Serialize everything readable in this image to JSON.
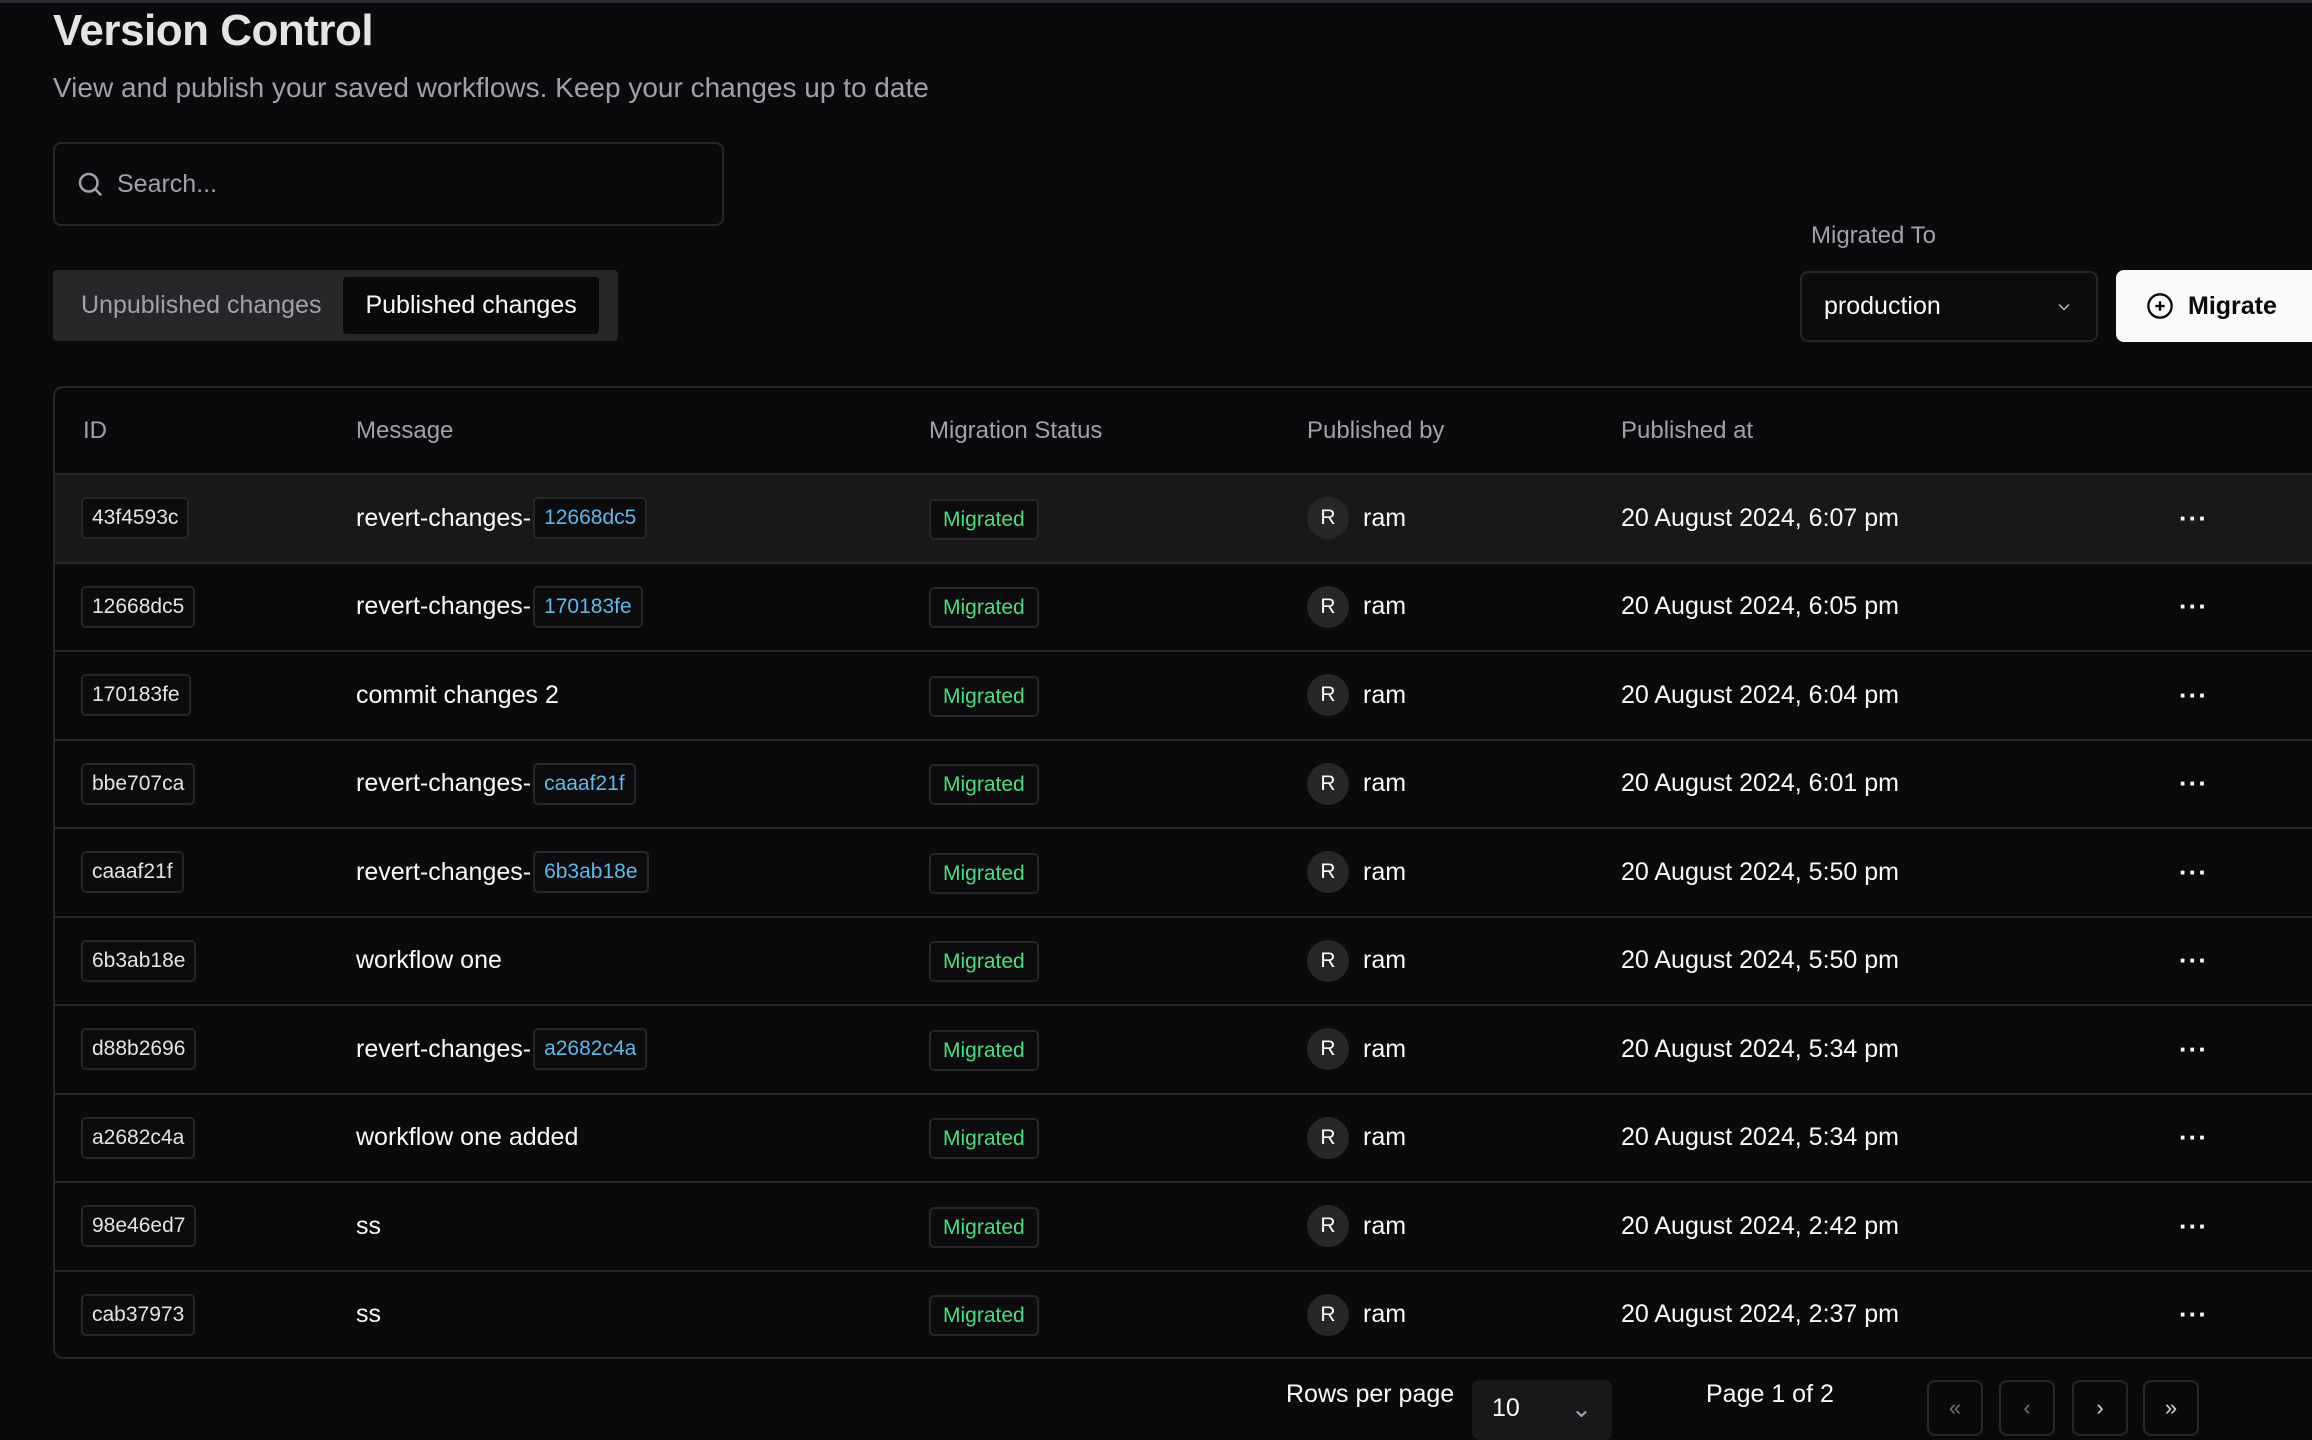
{
  "header": {
    "title": "Version Control",
    "subtitle": "View and publish your saved workflows. Keep your changes up to date"
  },
  "search": {
    "placeholder": "Search...",
    "value": ""
  },
  "tabs": [
    {
      "label": "Unpublished changes",
      "active": false
    },
    {
      "label": "Published changes",
      "active": true
    }
  ],
  "migration": {
    "label": "Migrated To",
    "selected": "production",
    "button_label": "Migrate"
  },
  "table": {
    "columns": [
      "ID",
      "Message",
      "Migration Status",
      "Published by",
      "Published at"
    ],
    "rows": [
      {
        "id": "43f4593c",
        "message": "revert-changes-",
        "ref": "12668dc5",
        "status": "Migrated",
        "avatar": "R",
        "user": "ram",
        "published_at": "20 August 2024, 6:07 pm"
      },
      {
        "id": "12668dc5",
        "message": "revert-changes-",
        "ref": "170183fe",
        "status": "Migrated",
        "avatar": "R",
        "user": "ram",
        "published_at": "20 August 2024, 6:05 pm"
      },
      {
        "id": "170183fe",
        "message": "commit changes 2",
        "ref": "",
        "status": "Migrated",
        "avatar": "R",
        "user": "ram",
        "published_at": "20 August 2024, 6:04 pm"
      },
      {
        "id": "bbe707ca",
        "message": "revert-changes-",
        "ref": "caaaf21f",
        "status": "Migrated",
        "avatar": "R",
        "user": "ram",
        "published_at": "20 August 2024, 6:01 pm"
      },
      {
        "id": "caaaf21f",
        "message": "revert-changes-",
        "ref": "6b3ab18e",
        "status": "Migrated",
        "avatar": "R",
        "user": "ram",
        "published_at": "20 August 2024, 5:50 pm"
      },
      {
        "id": "6b3ab18e",
        "message": "workflow one",
        "ref": "",
        "status": "Migrated",
        "avatar": "R",
        "user": "ram",
        "published_at": "20 August 2024, 5:50 pm"
      },
      {
        "id": "d88b2696",
        "message": "revert-changes-",
        "ref": "a2682c4a",
        "status": "Migrated",
        "avatar": "R",
        "user": "ram",
        "published_at": "20 August 2024, 5:34 pm"
      },
      {
        "id": "a2682c4a",
        "message": "workflow one added",
        "ref": "",
        "status": "Migrated",
        "avatar": "R",
        "user": "ram",
        "published_at": "20 August 2024, 5:34 pm"
      },
      {
        "id": "98e46ed7",
        "message": "ss",
        "ref": "",
        "status": "Migrated",
        "avatar": "R",
        "user": "ram",
        "published_at": "20 August 2024, 2:42 pm"
      },
      {
        "id": "cab37973",
        "message": "ss",
        "ref": "",
        "status": "Migrated",
        "avatar": "R",
        "user": "ram",
        "published_at": "20 August 2024, 2:37 pm"
      }
    ]
  },
  "pagination": {
    "rows_per_page_label": "Rows per page",
    "rows_per_page": "10",
    "page_text": "Page 1 of 2"
  },
  "colors": {
    "background": "#0a0a0c",
    "status_green": "#4ade80",
    "link_blue": "#5fb8e8",
    "border": "#27272a"
  }
}
